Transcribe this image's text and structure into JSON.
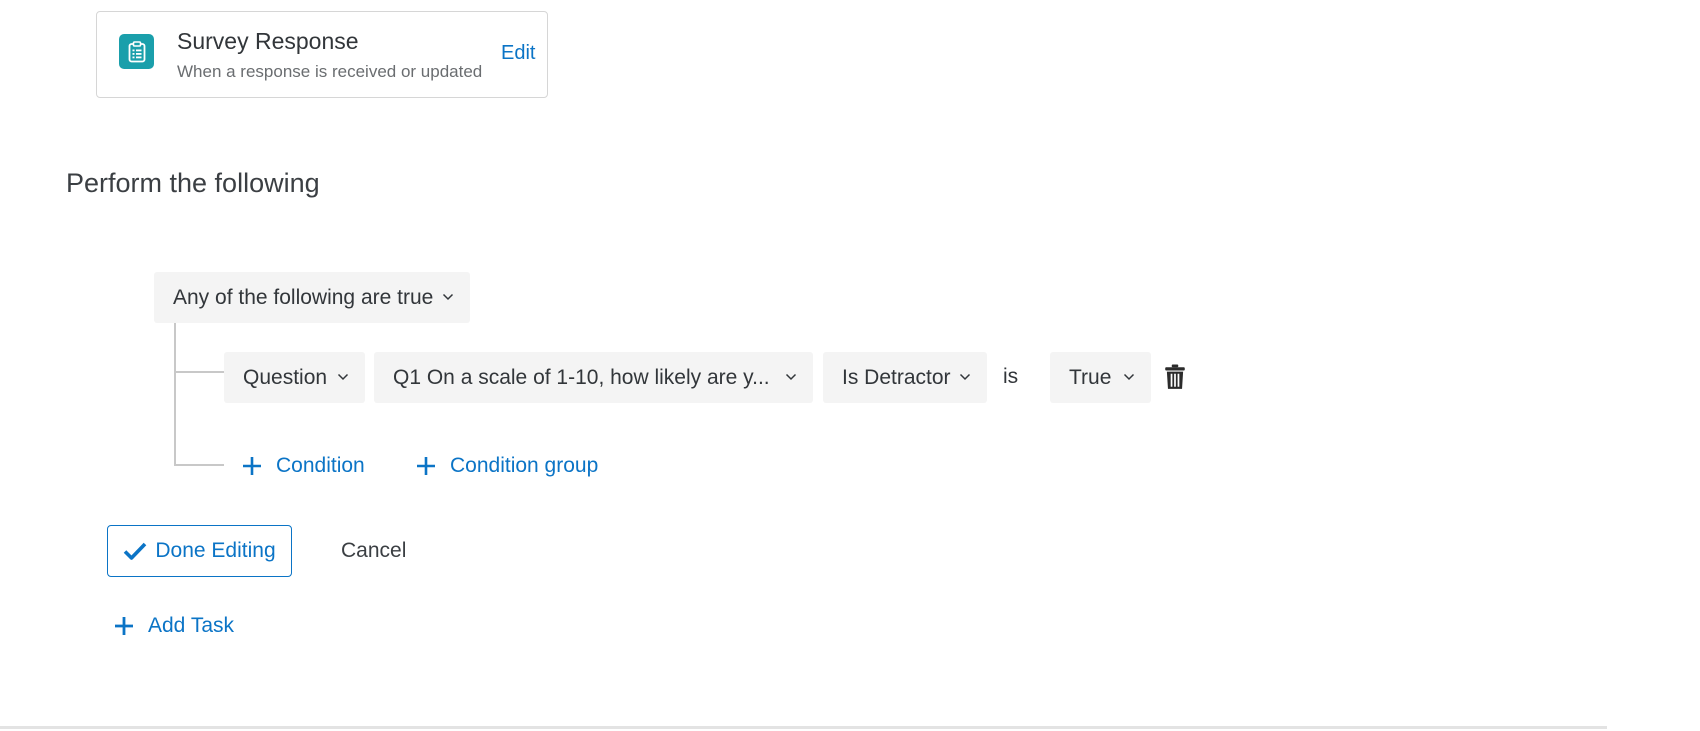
{
  "trigger_card": {
    "icon": "clipboard-list-icon",
    "title": "Survey Response",
    "subtitle": "When a response is received or updated",
    "edit_label": "Edit",
    "accent_color": "#1a9fab"
  },
  "section_title": "Perform the following",
  "condition_group": {
    "logic_dropdown": "Any of the following are true",
    "conditions": [
      {
        "type_dropdown": "Question",
        "question_dropdown": "Q1 On a scale of 1-10, how likely are y...",
        "operator_dropdown": "Is Detractor",
        "is_label": "is",
        "value_dropdown": "True",
        "delete_icon": "trash-icon"
      }
    ],
    "add_condition_label": "Condition",
    "add_condition_group_label": "Condition group"
  },
  "actions": {
    "done_label": "Done Editing",
    "cancel_label": "Cancel",
    "add_task_label": "Add Task"
  },
  "colors": {
    "link": "#0b74c6",
    "dropdown_bg": "#f4f4f4",
    "text": "#32363a"
  }
}
